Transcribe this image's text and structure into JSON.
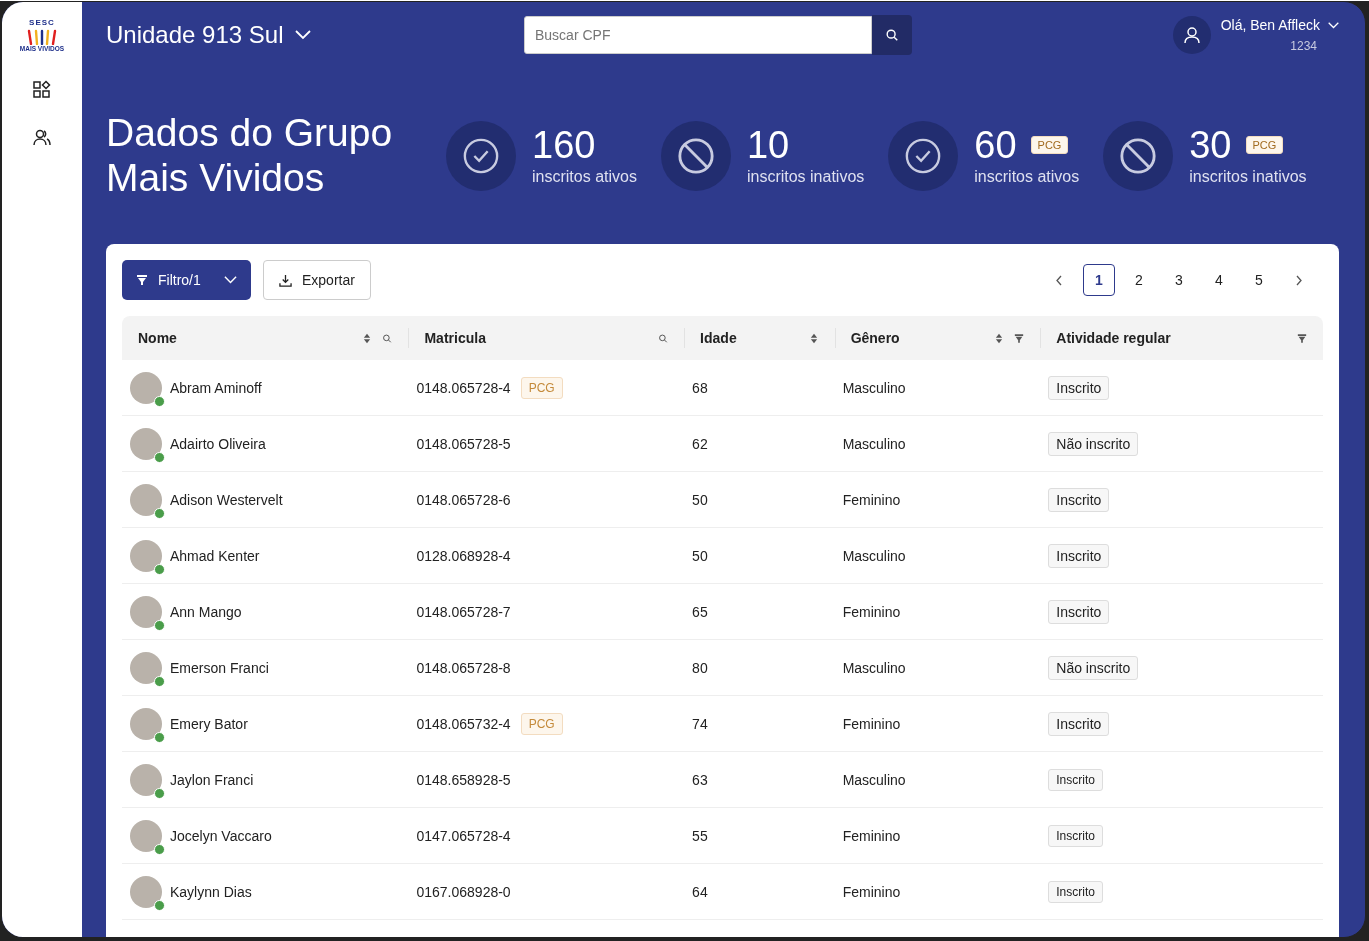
{
  "logo": {
    "top": "SESC",
    "bottom": "MAIS VIVIDOS"
  },
  "header": {
    "unit": "Unidade 913 Sul",
    "search": {
      "placeholder": "Buscar CPF"
    },
    "user": {
      "greeting": "Olá, Ben Affleck",
      "code": "1234"
    }
  },
  "page_title": "Dados do Grupo Mais Vividos",
  "stats": [
    {
      "kind": "active",
      "value": "160",
      "label": "inscritos ativos"
    },
    {
      "kind": "inactive",
      "value": "10",
      "label": "inscritos inativos"
    },
    {
      "kind": "active",
      "value": "60",
      "badge": "PCG",
      "label": "inscritos ativos"
    },
    {
      "kind": "inactive",
      "value": "30",
      "badge": "PCG",
      "label": "inscritos inativos"
    }
  ],
  "toolbar": {
    "filter": "Filtro/1",
    "export": "Exportar"
  },
  "pagination": {
    "pages": [
      {
        "label": "1",
        "selected": true
      },
      {
        "label": "2",
        "selected": false
      },
      {
        "label": "3",
        "selected": false
      },
      {
        "label": "4",
        "selected": false
      },
      {
        "label": "5",
        "selected": false
      }
    ]
  },
  "table": {
    "columns": [
      {
        "label": "Nome",
        "icons": [
          {
            "kind": "sort"
          },
          {
            "kind": "search"
          }
        ]
      },
      {
        "label": "Matricula",
        "icons": [
          {
            "kind": "search"
          }
        ]
      },
      {
        "label": "Idade",
        "icons": [
          {
            "kind": "sort"
          }
        ]
      },
      {
        "label": "Gênero",
        "icons": [
          {
            "kind": "sort"
          },
          {
            "kind": "filter"
          }
        ]
      },
      {
        "label": "Atividade regular",
        "icons": [
          {
            "kind": "filter"
          }
        ]
      }
    ],
    "rows": [
      {
        "name": "Abram Aminoff",
        "online": true,
        "matricula": "0148.065728-4",
        "badge": "PCG",
        "age": "68",
        "gender": "Masculino",
        "activity": "Inscrito",
        "kind": "regular"
      },
      {
        "name": "Adairto Oliveira",
        "online": true,
        "matricula": "0148.065728-5",
        "age": "62",
        "gender": "Masculino",
        "activity": "Não inscrito",
        "kind": "regular"
      },
      {
        "name": "Adison Westervelt",
        "online": true,
        "matricula": "0148.065728-6",
        "age": "50",
        "gender": "Feminino",
        "activity": "Inscrito",
        "kind": "regular"
      },
      {
        "name": "Ahmad Kenter",
        "online": true,
        "matricula": "0128.068928-4",
        "age": "50",
        "gender": "Masculino",
        "activity": "Inscrito",
        "kind": "regular"
      },
      {
        "name": "Ann Mango",
        "online": true,
        "matricula": "0148.065728-7",
        "age": "65",
        "gender": "Feminino",
        "activity": "Inscrito",
        "kind": "regular"
      },
      {
        "name": "Emerson Franci",
        "online": true,
        "matricula": "0148.065728-8",
        "age": "80",
        "gender": "Masculino",
        "activity": "Não inscrito",
        "kind": "regular"
      },
      {
        "name": "Emery Bator",
        "online": true,
        "matricula": "0148.065732-4",
        "badge": "PCG",
        "age": "74",
        "gender": "Feminino",
        "activity": "Inscrito",
        "kind": "regular"
      },
      {
        "name": "Jaylon Franci",
        "online": true,
        "matricula": "0148.658928-5",
        "age": "63",
        "gender": "Masculino",
        "activity": "Inscrito",
        "kind": "compact"
      },
      {
        "name": "Jocelyn Vaccaro",
        "online": true,
        "matricula": "0147.065728-4",
        "age": "55",
        "gender": "Feminino",
        "activity": "Inscrito",
        "kind": "compact"
      },
      {
        "name": "Kaylynn Dias",
        "online": true,
        "matricula": "0167.068928-0",
        "age": "64",
        "gender": "Feminino",
        "activity": "Inscrito",
        "kind": "compact"
      }
    ]
  }
}
